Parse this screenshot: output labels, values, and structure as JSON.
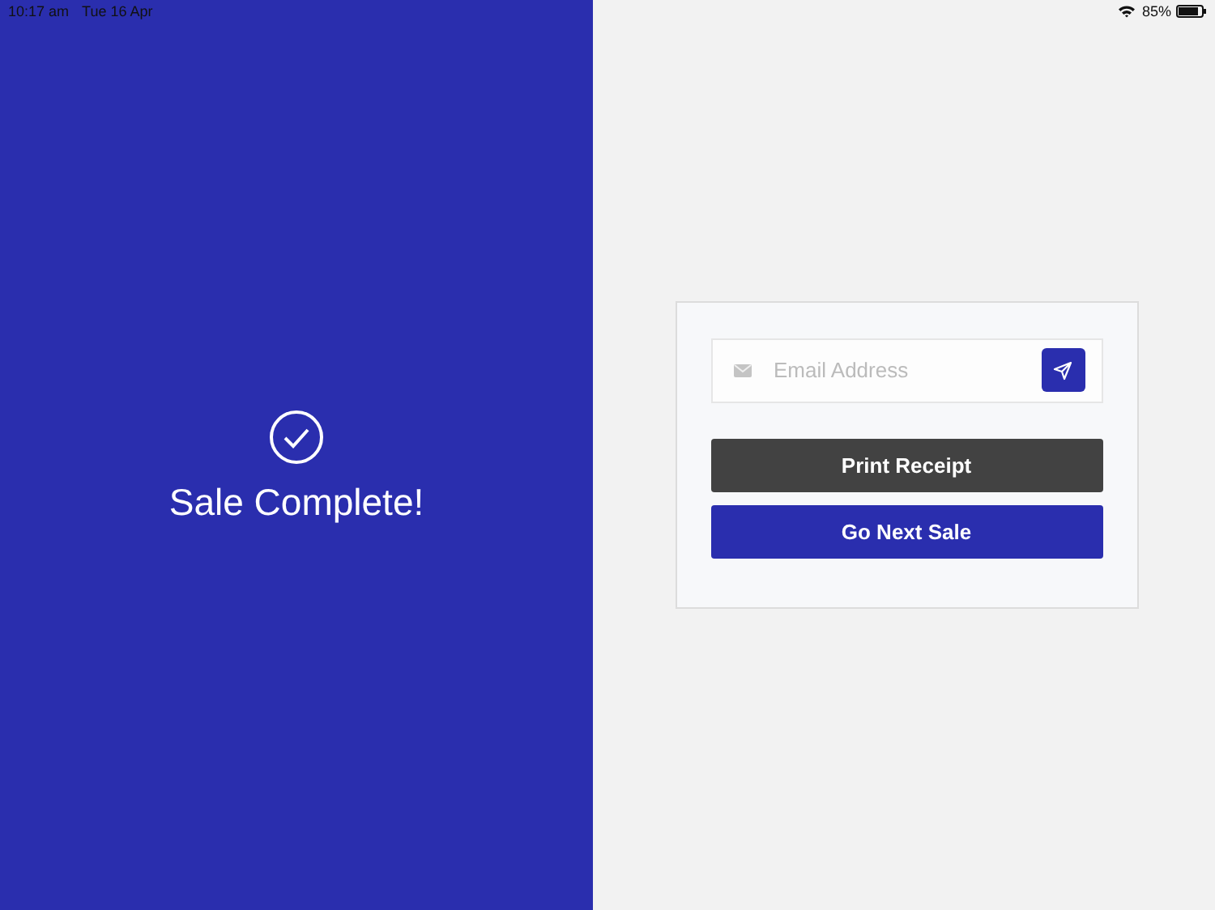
{
  "status_bar": {
    "time": "10:17 am",
    "date": "Tue 16 Apr",
    "battery": "85%"
  },
  "confirmation": {
    "title": "Sale Complete!"
  },
  "receipt_card": {
    "email_field": {
      "placeholder": "Email Address"
    },
    "buttons": [
      {
        "label": "Print Receipt",
        "kind": "dark"
      },
      {
        "label": "Go Next Sale",
        "kind": "primary"
      }
    ]
  }
}
